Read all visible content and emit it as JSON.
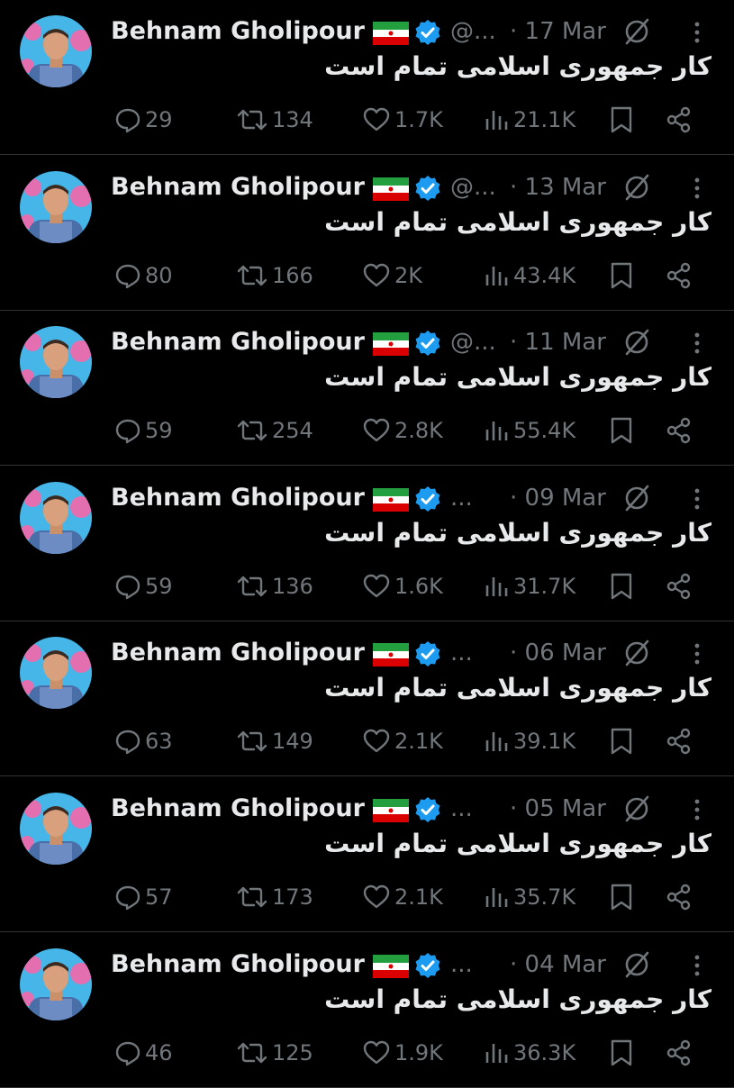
{
  "tweets": [
    {
      "name": "Behnam Gholipour",
      "handle": "@...",
      "time": "· 17 Mar",
      "text": "کار جمهوری اسلامی تمام است",
      "replies": "29",
      "retweets": "134",
      "likes": "1.7K",
      "views": "21.1K"
    },
    {
      "name": "Behnam Gholipour",
      "handle": "@...",
      "time": "· 13 Mar",
      "text": "کار جمهوری اسلامی تمام است",
      "replies": "80",
      "retweets": "166",
      "likes": "2K",
      "views": "43.4K"
    },
    {
      "name": "Behnam Gholipour",
      "handle": "@...",
      "time": "· 11 Mar",
      "text": "کار جمهوری اسلامی تمام است",
      "replies": "59",
      "retweets": "254",
      "likes": "2.8K",
      "views": "55.4K"
    },
    {
      "name": "Behnam Gholipour",
      "handle": "...",
      "time": "· 09 Mar",
      "text": "کار جمهوری اسلامی تمام است",
      "replies": "59",
      "retweets": "136",
      "likes": "1.6K",
      "views": "31.7K"
    },
    {
      "name": "Behnam Gholipour",
      "handle": "...",
      "time": "· 06 Mar",
      "text": "کار جمهوری اسلامی تمام است",
      "replies": "63",
      "retweets": "149",
      "likes": "2.1K",
      "views": "39.1K"
    },
    {
      "name": "Behnam Gholipour",
      "handle": "...",
      "time": "· 05 Mar",
      "text": "کار جمهوری اسلامی تمام است",
      "replies": "57",
      "retweets": "173",
      "likes": "2.1K",
      "views": "35.7K"
    },
    {
      "name": "Behnam Gholipour",
      "handle": "...",
      "time": "· 04 Mar",
      "text": "کار جمهوری اسلامی تمام است",
      "replies": "46",
      "retweets": "125",
      "likes": "1.9K",
      "views": "36.3K"
    }
  ],
  "icons": {
    "reply": "reply-icon",
    "retweet": "retweet-icon",
    "like": "heart-icon",
    "views": "views-icon",
    "bookmark": "bookmark-icon",
    "share": "share-icon",
    "edit": "edited-icon",
    "more": "more-icon",
    "verified": "verified-badge-icon",
    "flag": "iran-flag-icon"
  },
  "colors": {
    "background": "#000000",
    "text": "#e7e9ea",
    "muted": "#71767b",
    "verified": "#1d9bf0",
    "divider": "#2f3336"
  }
}
